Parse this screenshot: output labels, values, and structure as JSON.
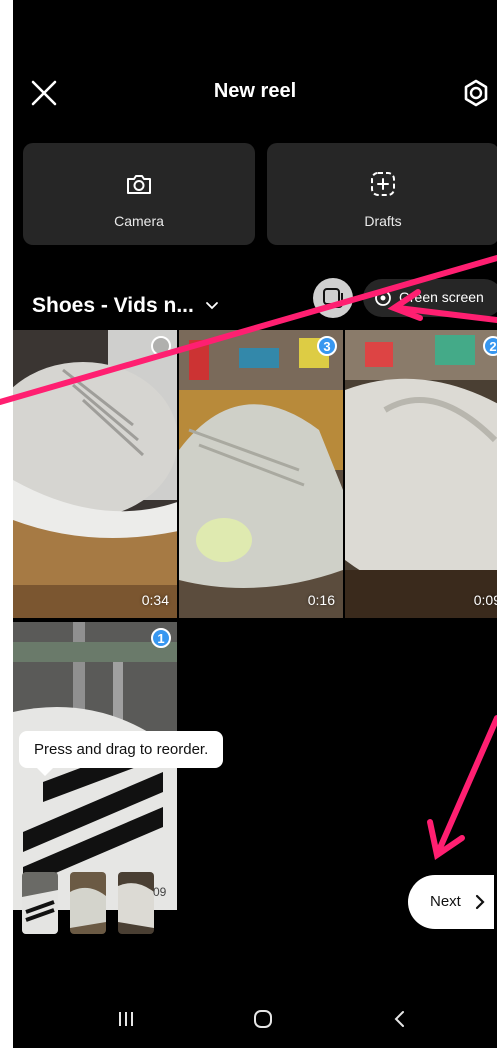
{
  "header": {
    "title": "New reel"
  },
  "tiles": [
    {
      "label": "Camera",
      "icon": "camera-icon"
    },
    {
      "label": "Drafts",
      "icon": "drafts-icon"
    }
  ],
  "album": {
    "name": "Shoes - Vids n...",
    "icon": "chevron-down-icon"
  },
  "controls": {
    "multi_select_icon": "multi-select-icon",
    "green_screen_label": "Green screen"
  },
  "grid": [
    {
      "duration": "0:34",
      "selected": false,
      "order": ""
    },
    {
      "duration": "0:16",
      "selected": true,
      "order": "3"
    },
    {
      "duration": "0:09",
      "selected": true,
      "order": "2"
    },
    {
      "duration": "",
      "selected": true,
      "order": "1"
    }
  ],
  "tray": {
    "tooltip": "Press and drag to reorder.",
    "partial_duration": "09"
  },
  "next_button": {
    "label": "Next"
  },
  "system_nav": [
    "recents-icon",
    "home-icon",
    "back-icon"
  ],
  "colors": {
    "background": "#000000",
    "selection": "#3797f0",
    "annotation_arrow": "#ff1f71"
  }
}
